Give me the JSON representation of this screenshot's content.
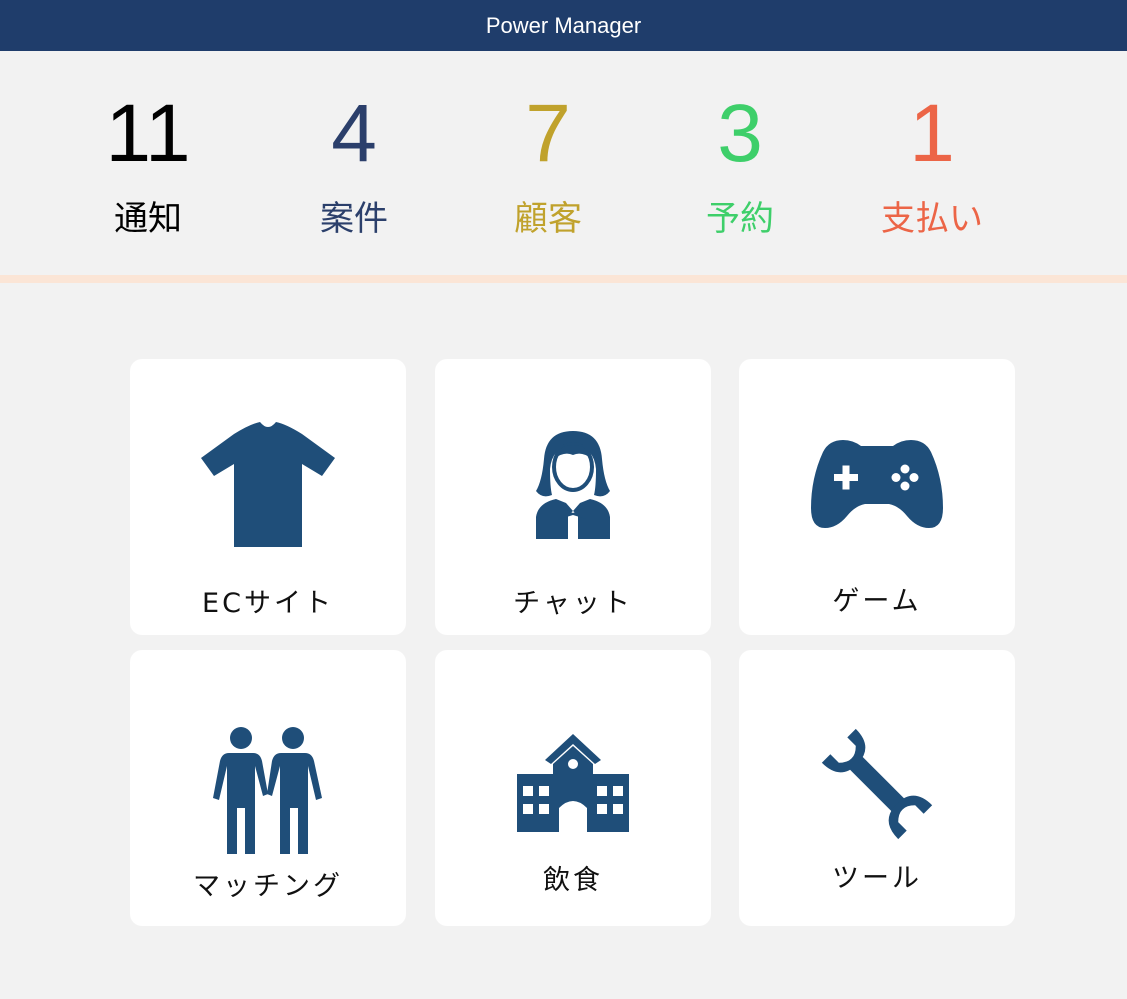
{
  "app": {
    "title": "Power Manager"
  },
  "colors": {
    "header_bg": "#1f3d6b",
    "icon": "#1f4e79",
    "divider": "#fbe5d6"
  },
  "stats": [
    {
      "value": "11",
      "label": "通知",
      "color": "#000000"
    },
    {
      "value": "4",
      "label": "案件",
      "color": "#2b3f6b"
    },
    {
      "value": "7",
      "label": "顧客",
      "color": "#c0a22c"
    },
    {
      "value": "3",
      "label": "予約",
      "color": "#3ecf6a"
    },
    {
      "value": "1",
      "label": "支払い",
      "color": "#ec6547"
    }
  ],
  "menu": [
    {
      "label": "ECサイト",
      "icon": "tshirt-icon"
    },
    {
      "label": "チャット",
      "icon": "woman-icon"
    },
    {
      "label": "ゲーム",
      "icon": "gamepad-icon"
    },
    {
      "label": "マッチング",
      "icon": "couple-icon"
    },
    {
      "label": "飲食",
      "icon": "school-building-icon"
    },
    {
      "label": "ツール",
      "icon": "wrench-icon"
    }
  ]
}
